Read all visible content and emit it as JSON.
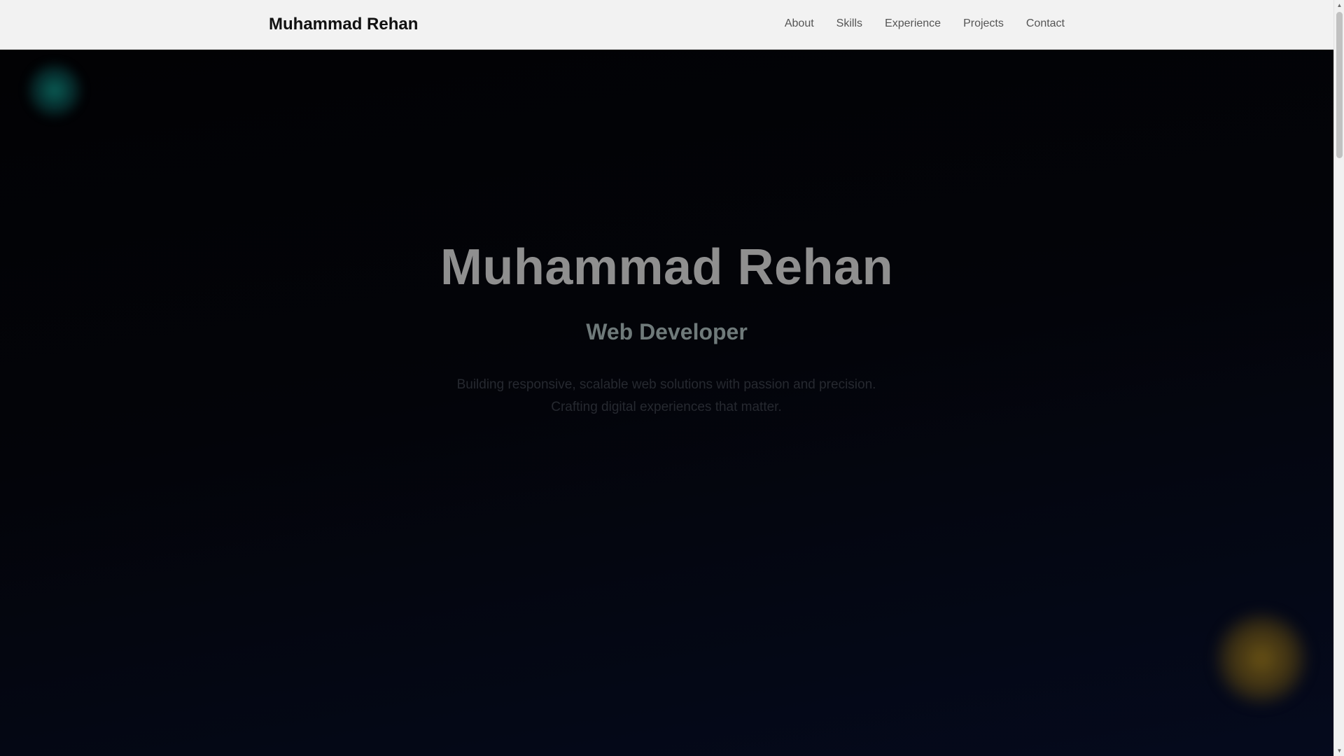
{
  "navbar": {
    "brand": "Muhammad Rehan",
    "links": [
      {
        "label": "About"
      },
      {
        "label": "Skills"
      },
      {
        "label": "Experience"
      },
      {
        "label": "Projects"
      },
      {
        "label": "Contact"
      }
    ]
  },
  "hero": {
    "title": "Muhammad Rehan",
    "subtitle": "Web Developer",
    "description_line1": "Building responsive, scalable web solutions with passion and precision.",
    "description_line2": "Crafting digital experiences that matter."
  },
  "colors": {
    "navbar_bg": "#f2f2f2",
    "hero_bg_dark": "#020204",
    "hero_bg_navy": "#050a1d",
    "glow_teal": "#0c6e64",
    "glow_amber": "#6e5514",
    "title_text": "#8f8f8f"
  }
}
